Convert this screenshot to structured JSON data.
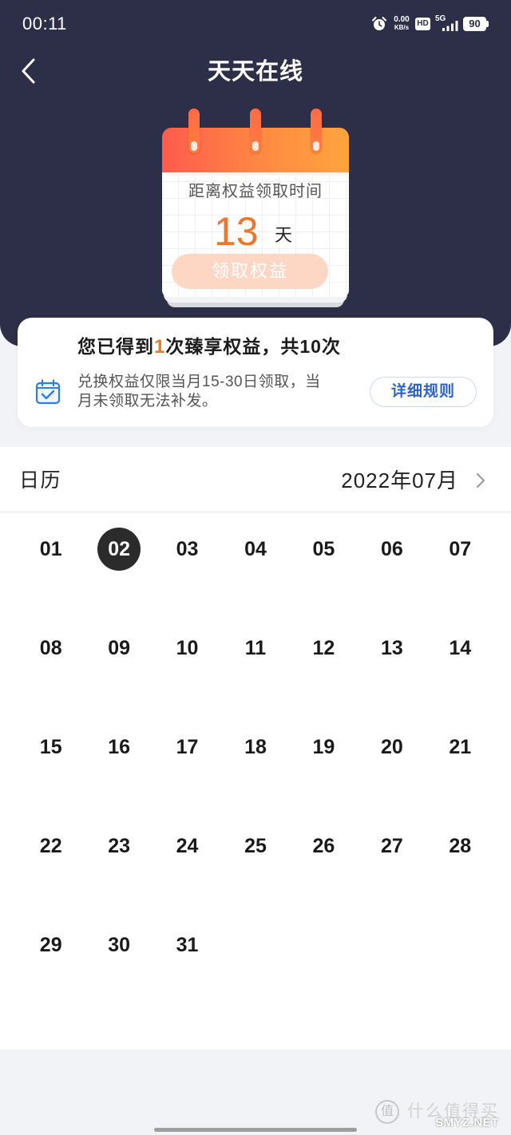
{
  "colors": {
    "header_bg": "#2d2e48",
    "accent_orange": "#ec772c",
    "link_blue": "#2a63cc",
    "selected_day_bg": "#2b2b2b",
    "page_bg": "#f2f3f6"
  },
  "status_bar": {
    "time": "00:11",
    "alarm_icon": "alarm-clock-icon",
    "net_speed_value": "0.00",
    "net_speed_unit": "KB/s",
    "hd_badge": "HD",
    "network_type": "5G",
    "signal_icon": "signal-bars-icon",
    "battery_level": "90"
  },
  "header": {
    "back_icon": "chevron-left-icon",
    "title": "天天在线"
  },
  "countdown_card": {
    "caption": "距离权益领取时间",
    "days_remaining": "13",
    "days_unit": "天",
    "claim_button_label": "领取权益"
  },
  "benefits_card": {
    "summary_prefix": "您已得到",
    "summary_count": "1",
    "summary_suffix": "次臻享权益，共10次",
    "notice_icon": "calendar-check-icon",
    "notice_lines": [
      "兑换权益仅限当月15-30日领取，当",
      "月未领取无法补发。"
    ],
    "rules_button_label": "详细规则"
  },
  "calendar": {
    "title": "日历",
    "month_label": "2022年07月",
    "next_month_icon": "chevron-right-icon",
    "selected_day": "02",
    "days": [
      "01",
      "02",
      "03",
      "04",
      "05",
      "06",
      "07",
      "08",
      "09",
      "10",
      "11",
      "12",
      "13",
      "14",
      "15",
      "16",
      "17",
      "18",
      "19",
      "20",
      "21",
      "22",
      "23",
      "24",
      "25",
      "26",
      "27",
      "28",
      "29",
      "30",
      "31"
    ]
  },
  "watermark": {
    "logo_char": "值",
    "site_name": "什么值得买",
    "domain": "SMYZ.NET"
  }
}
